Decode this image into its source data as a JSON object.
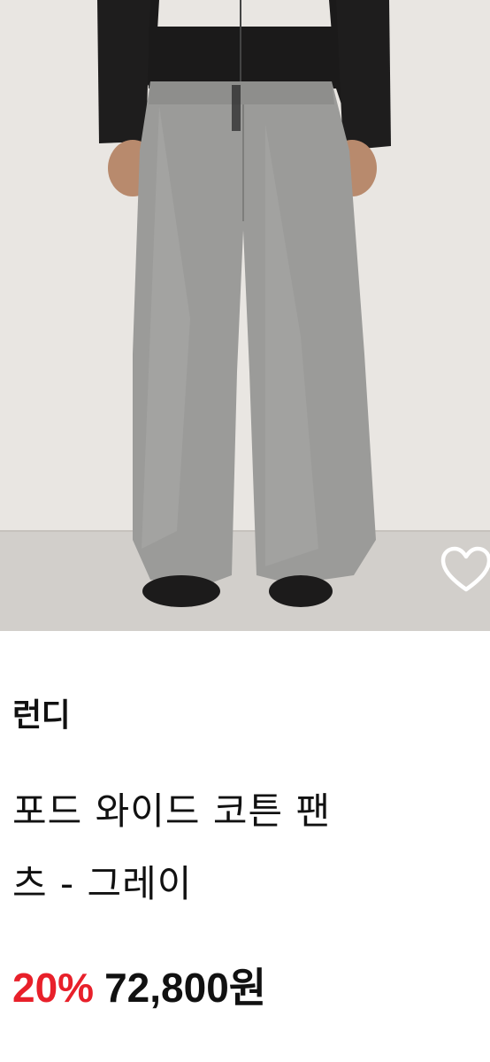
{
  "product": {
    "brand": "런디",
    "title_line1": "포드 와이드 코튼 팬",
    "title_line2": "츠 - 그레이",
    "discount": "20%",
    "price": "72,800원"
  },
  "colors": {
    "accent_red": "#e8202a",
    "text": "#111111"
  },
  "icons": {
    "wishlist": "heart-outline-icon"
  }
}
